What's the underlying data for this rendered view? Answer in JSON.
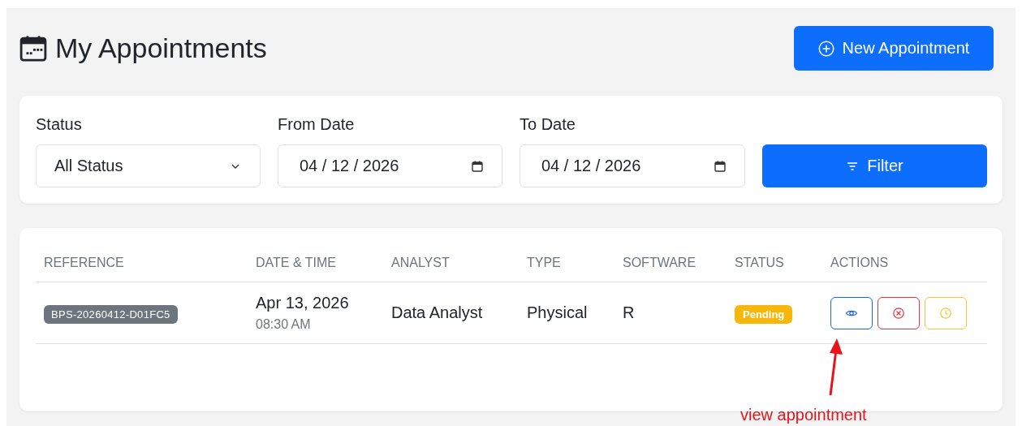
{
  "page": {
    "title": "My Appointments"
  },
  "new_button": {
    "label": "New Appointment"
  },
  "filters": {
    "status": {
      "label": "Status",
      "value": "All Status"
    },
    "from_date": {
      "label": "From Date",
      "value": "04 / 12 / 2026"
    },
    "to_date": {
      "label": "To Date",
      "value": "04 / 12 / 2026"
    },
    "filter_button": {
      "label": "Filter"
    }
  },
  "table": {
    "columns": [
      "REFERENCE",
      "DATE & TIME",
      "ANALYST",
      "TYPE",
      "SOFTWARE",
      "STATUS",
      "ACTIONS"
    ],
    "rows": [
      {
        "reference": "BPS-20260412-D01FC5",
        "date": "Apr 13, 2026",
        "time": "08:30 AM",
        "analyst": "Data Analyst",
        "type": "Physical",
        "software": "R",
        "status": {
          "label": "Pending",
          "color": "#f6b70a"
        },
        "actions": [
          {
            "kind": "view",
            "color": "#1a66e0"
          },
          {
            "kind": "cancel",
            "color": "#dc3545"
          },
          {
            "kind": "reschedule",
            "color": "#f6c636"
          }
        ]
      }
    ]
  },
  "annotation": {
    "text": "view appointment"
  }
}
